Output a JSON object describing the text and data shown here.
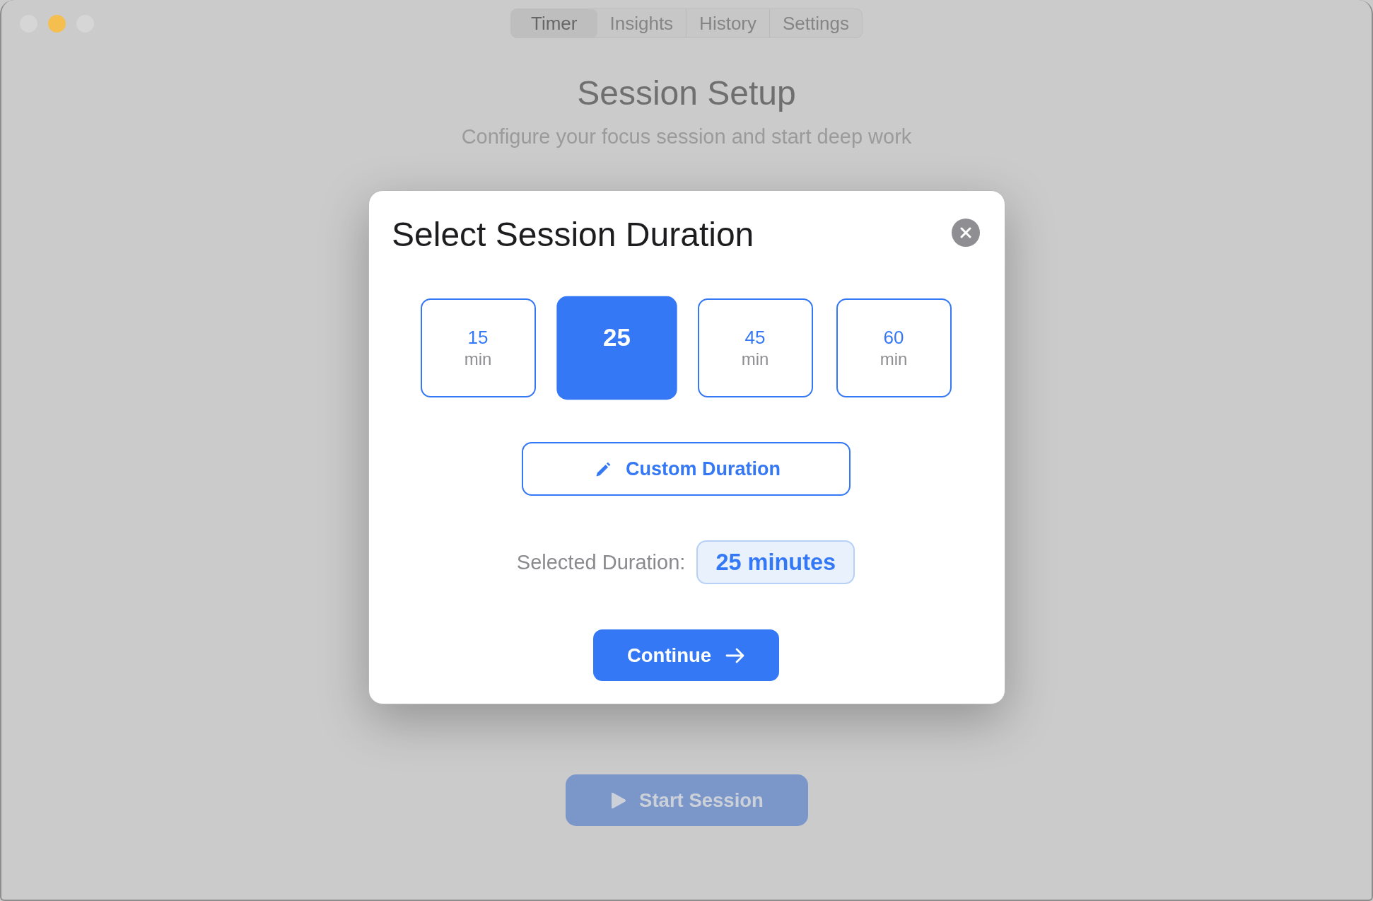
{
  "window": {
    "controls": [
      {
        "color": "#d6d6d6"
      },
      {
        "color": "#f5bf4f"
      },
      {
        "color": "#d6d6d6"
      }
    ]
  },
  "tabs": [
    {
      "label": "Timer",
      "selected": true
    },
    {
      "label": "Insights",
      "selected": false
    },
    {
      "label": "History",
      "selected": false
    },
    {
      "label": "Settings",
      "selected": false
    }
  ],
  "page": {
    "title": "Session Setup",
    "subtitle": "Configure your focus session and start deep work",
    "start_button": "Start Session"
  },
  "dialog": {
    "title": "Select Session Duration",
    "options": [
      {
        "value": "15",
        "unit": "min",
        "selected": false
      },
      {
        "value": "25",
        "selected": true
      },
      {
        "value": "45",
        "unit": "min",
        "selected": false
      },
      {
        "value": "60",
        "unit": "min",
        "selected": false
      }
    ],
    "custom_button": "Custom Duration",
    "summary": {
      "label": "Selected Duration:",
      "value": "25 minutes"
    },
    "continue_button": "Continue"
  }
}
